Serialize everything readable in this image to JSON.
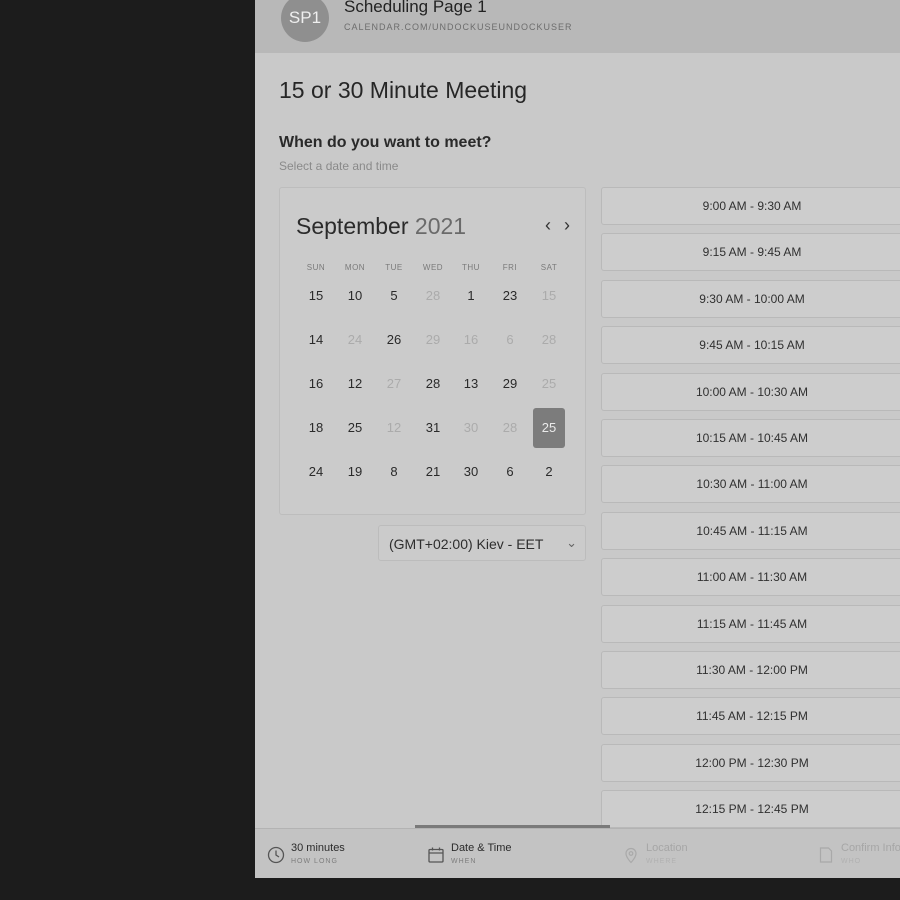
{
  "header": {
    "avatar_initials": "SP1",
    "title": "Scheduling Page 1",
    "url": "CALENDAR.COM/UNDOCKUSEUNDOCKUSER"
  },
  "meeting_title": "15 or 30 Minute Meeting",
  "question": "When do you want to meet?",
  "hint": "Select a date and time",
  "calendar": {
    "month": "September",
    "year": "2021",
    "prev_glyph": "‹",
    "next_glyph": "›",
    "weekdays": [
      "SUN",
      "MON",
      "TUE",
      "WED",
      "THU",
      "FRI",
      "SAT"
    ],
    "rows": [
      [
        {
          "t": "15",
          "m": false
        },
        {
          "t": "10",
          "m": false
        },
        {
          "t": "5",
          "m": false
        },
        {
          "t": "28",
          "m": true
        },
        {
          "t": "1",
          "m": false
        },
        {
          "t": "23",
          "m": false
        },
        {
          "t": "15",
          "m": true
        }
      ],
      [
        {
          "t": "14",
          "m": false
        },
        {
          "t": "24",
          "m": true
        },
        {
          "t": "26",
          "m": false
        },
        {
          "t": "29",
          "m": true
        },
        {
          "t": "16",
          "m": true
        },
        {
          "t": "6",
          "m": true
        },
        {
          "t": "28",
          "m": true
        }
      ],
      [
        {
          "t": "16",
          "m": false
        },
        {
          "t": "12",
          "m": false
        },
        {
          "t": "27",
          "m": true
        },
        {
          "t": "28",
          "m": false
        },
        {
          "t": "13",
          "m": false
        },
        {
          "t": "29",
          "m": false
        },
        {
          "t": "25",
          "m": true
        }
      ],
      [
        {
          "t": "18",
          "m": false
        },
        {
          "t": "25",
          "m": false
        },
        {
          "t": "12",
          "m": true
        },
        {
          "t": "31",
          "m": false
        },
        {
          "t": "30",
          "m": true
        },
        {
          "t": "28",
          "m": true
        },
        {
          "t": "25",
          "m": false,
          "sel": true
        }
      ],
      [
        {
          "t": "24",
          "m": false
        },
        {
          "t": "19",
          "m": false
        },
        {
          "t": "8",
          "m": false
        },
        {
          "t": "21",
          "m": false
        },
        {
          "t": "30",
          "m": false
        },
        {
          "t": "6",
          "m": false
        },
        {
          "t": "2",
          "m": false
        }
      ]
    ]
  },
  "timezone": {
    "label": "(GMT+02:00) Kiev - EET",
    "chevron": "⌄"
  },
  "slots": [
    "9:00 AM - 9:30 AM",
    "9:15 AM - 9:45 AM",
    "9:30 AM - 10:00 AM",
    "9:45 AM - 10:15 AM",
    "10:00 AM - 10:30 AM",
    "10:15 AM - 10:45 AM",
    "10:30 AM - 11:00 AM",
    "10:45 AM - 11:15 AM",
    "11:00 AM - 11:30 AM",
    "11:15 AM - 11:45 AM",
    "11:30 AM - 12:00 PM",
    "11:45 AM - 12:15 PM",
    "12:00 PM - 12:30 PM",
    "12:15 PM - 12:45 PM"
  ],
  "footer": {
    "steps": [
      {
        "title": "30 minutes",
        "sub": "HOW LONG",
        "icon": "clock-icon",
        "active": true
      },
      {
        "title": "Date & Time",
        "sub": "WHEN",
        "icon": "calendar-icon",
        "active": true
      },
      {
        "title": "Location",
        "sub": "WHERE",
        "icon": "location-pin-icon",
        "active": false
      },
      {
        "title": "Confirm Info",
        "sub": "WHO",
        "icon": "document-icon",
        "active": false
      }
    ]
  },
  "colors": {
    "selected_day": "#7c7c7c",
    "progress": "#7a7a7a"
  }
}
